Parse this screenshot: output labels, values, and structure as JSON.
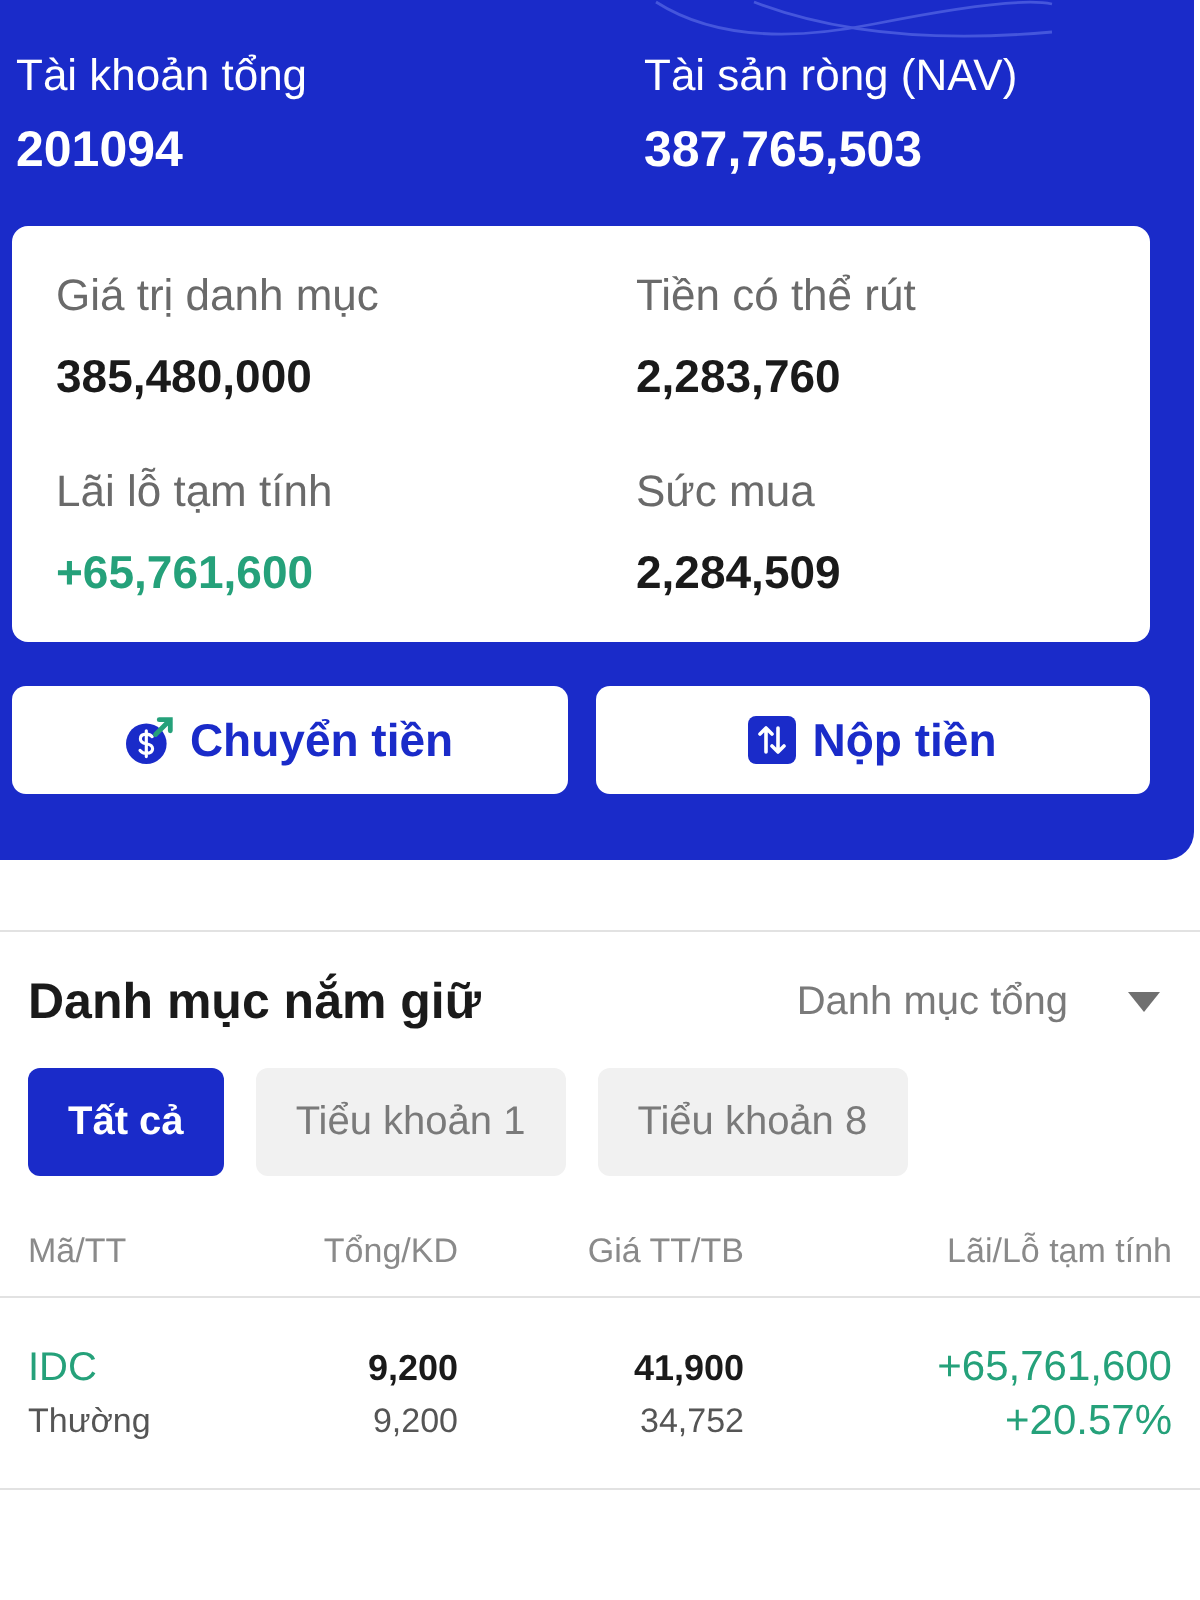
{
  "account_header": {
    "items": [
      {
        "label": "Tài khoản tổng",
        "value": "201094"
      },
      {
        "label": "Tài sản ròng (NAV)",
        "value": "387,765,503"
      }
    ]
  },
  "summary_card": {
    "items": [
      {
        "label": "Giá trị danh mục",
        "value": "385,480,000",
        "color": "#1a1a1a"
      },
      {
        "label": "Tiền có thể rút",
        "value": "2,283,760",
        "color": "#1a1a1a"
      },
      {
        "label": "Lãi lỗ tạm tính",
        "value": "+65,761,600",
        "color": "#25a17a"
      },
      {
        "label": "Sức mua",
        "value": "2,284,509",
        "color": "#1a1a1a"
      }
    ]
  },
  "actions": [
    {
      "label": "Chuyển tiền",
      "kind": "transfer"
    },
    {
      "label": "Nộp tiền",
      "kind": "deposit"
    }
  ],
  "holdings": {
    "title": "Danh mục nắm giữ",
    "dropdown": "Danh mục tổng",
    "tabs": [
      {
        "label": "Tất cả",
        "selected": true
      },
      {
        "label": "Tiểu khoản 1",
        "selected": false
      },
      {
        "label": "Tiểu khoản 8",
        "selected": false
      }
    ],
    "table": {
      "columns": [
        "Mã/TT",
        "Tổng/KD",
        "Giá TT/TB",
        "Lãi/Lỗ tạm tính"
      ],
      "rows": [
        {
          "symbol": "IDC",
          "type": "Thường",
          "total": "9,200",
          "available": "9,200",
          "market_price": "41,900",
          "avg_price": "34,752",
          "pnl": "+65,761,600",
          "pnl_pct": "+20.57%",
          "color": "#25a17a"
        }
      ]
    }
  }
}
